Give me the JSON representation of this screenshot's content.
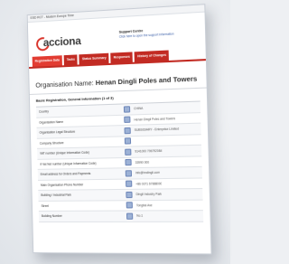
{
  "window": {
    "title": "ESD RCT - Modern Europe Time"
  },
  "header": {
    "logo_text": "acciona",
    "support_heading": "Support Centre",
    "support_text": "Click here to open the support information"
  },
  "tabs": [
    {
      "label": "Registration Data"
    },
    {
      "label": "Tasks"
    },
    {
      "label": "Status Summary"
    },
    {
      "label": "Responses"
    },
    {
      "label": "History of Changes"
    }
  ],
  "org": {
    "prefix": "Organisation Name:",
    "name": "Henan Dingli Poles and Towers"
  },
  "section_title": "Basic Registration, General Information (1 of 3)",
  "rows": [
    {
      "label": "Country",
      "value": "CHINA"
    },
    {
      "label": "Organisation Name",
      "value": "Henan Dingli Poles and Towers"
    },
    {
      "label": "Organisation Legal Structure",
      "value": "SUBSIDIARY - Enterprise Limited"
    },
    {
      "label": "Company Structure",
      "value": ""
    },
    {
      "label": "VAT number (Unique Information Code)",
      "value": "9141000 796792084"
    },
    {
      "label": "If Vat Not number (Unique Information Code)",
      "value": "33990 000"
    },
    {
      "label": "Email address for Orders and Payments",
      "value": "info@hndingli.com"
    },
    {
      "label": "Main Organisation Phone Number",
      "value": "+86 0371 67888000"
    },
    {
      "label": "Building / Industrial Park",
      "value": "Dingli Industry Park"
    },
    {
      "label": "Street",
      "value": "Tongbai Ave"
    },
    {
      "label": "Building Number",
      "value": "No.1"
    }
  ]
}
